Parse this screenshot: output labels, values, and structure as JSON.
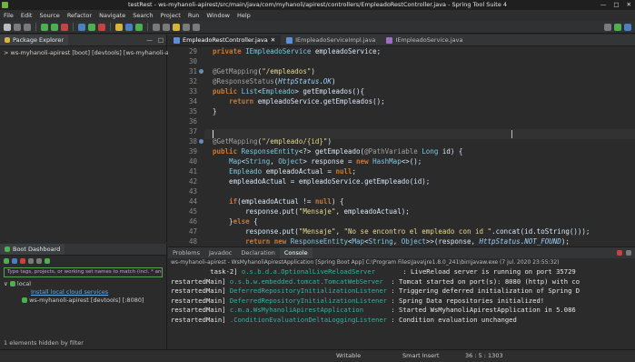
{
  "window": {
    "title": "testRest - ws-myhanoli-apirest/src/main/java/com/myhanoli/apirest/controllers/EmpleadoRestController.java - Spring Tool Suite 4"
  },
  "menu": [
    "File",
    "Edit",
    "Source",
    "Refactor",
    "Navigate",
    "Search",
    "Project",
    "Run",
    "Window",
    "Help"
  ],
  "package_explorer": {
    "tab_label": "Package Explorer",
    "project": "> ws-myhanoli-apirest [boot] [devtools] [ws-myhanoli-apirest]"
  },
  "boot_dashboard": {
    "tab_label": "Boot Dashboard",
    "filter_placeholder": "Type tags, projects, or working set names to match (incl. * and ? wildcards)",
    "local_label": "local",
    "install_link": "Install local cloud services",
    "app_label": "ws-myhanoli-apirest [devtools] [:8080]",
    "footer": "1 elements hidden by filter"
  },
  "editor": {
    "tabs": [
      {
        "label": "EmpleadoRestController.java",
        "active": true
      },
      {
        "label": "IEmpleadoServiceImpl.java",
        "active": false
      },
      {
        "label": "IEmpleadoService.java",
        "active": false
      }
    ],
    "line_numbers": [
      "29",
      "30",
      "31",
      "32",
      "33",
      "34",
      "35",
      "36",
      "37",
      "38",
      "39",
      "40",
      "41",
      "42",
      "43",
      "44",
      "45",
      "46",
      "47",
      "48",
      "49"
    ],
    "code_lines": [
      "private IEmpleadoService empleadoService;",
      "",
      "@GetMapping(\"/empleados\")",
      "@ResponseStatus(HttpStatus.OK)",
      "public List<Empleado> getEmpleados(){",
      "    return empleadoService.getEmpleados();",
      "}",
      "",
      "",
      "@GetMapping(\"/empleado/{id}\")",
      "public ResponseEntity<?> getEmpleado(@PathVariable Long id) {",
      "    Map<String, Object> response = new HashMap<>();",
      "    Empleado empleadoActual = null;",
      "    empleadoActual = empleadoService.getEmpleado(id);",
      "",
      "    if(empleadoActual != null) {",
      "        response.put(\"Mensaje\", empleadoActual);",
      "    }else {",
      "        response.put(\"Mensaje\", \"No se encontro el empleado con id \".concat(id.toString()));",
      "        return new ResponseEntity<Map<String, Object>>(response, HttpStatus.NOT_FOUND);",
      "    }"
    ]
  },
  "bottom_panel": {
    "tabs": [
      "Problems",
      "Javadoc",
      "Declaration",
      "Console"
    ],
    "active_tab": "Console",
    "console_header": "ws-myhanoli-apirest - WsMyhanoliApirestApplication [Spring Boot App] C:\\Program Files\\Java\\jre1.8.0_241\\bin\\javaw.exe (7 jul. 2020 23:55:32)",
    "console_lines": [
      {
        "thread": "          task-2]",
        "logger": "o.s.b.d.a.OptionalLiveReloadServer      ",
        "msg": " : LiveReload server is running on port 35729"
      },
      {
        "thread": "restartedMain]",
        "logger": "o.s.b.w.embedded.tomcat.TomcatWebServer ",
        "msg": " : Tomcat started on port(s): 8080 (http) with co"
      },
      {
        "thread": "restartedMain]",
        "logger": "DeferredRepositoryInitializationListener",
        "msg": " : Triggering deferred initialization of Spring D"
      },
      {
        "thread": "restartedMain]",
        "logger": "DeferredRepositoryInitializationListener",
        "msg": " : Spring Data repositories initialized!"
      },
      {
        "thread": "restartedMain]",
        "logger": "c.m.a.WsMyhanoliApirestApplication      ",
        "msg": " : Started WsMyhanoliApirestApplication in 5.086"
      },
      {
        "thread": "restartedMain]",
        "logger": ".ConditionEvaluationDeltaLoggingListener",
        "msg": " : Condition evaluation unchanged"
      }
    ]
  },
  "status_bar": {
    "mode": "Writable",
    "insert": "Smart Insert",
    "position": "36 : 5 : 1303"
  },
  "colors": {
    "spring_green": "#6db33f",
    "console_logger": "#2bb5a0",
    "keyword": "#cc7832"
  }
}
